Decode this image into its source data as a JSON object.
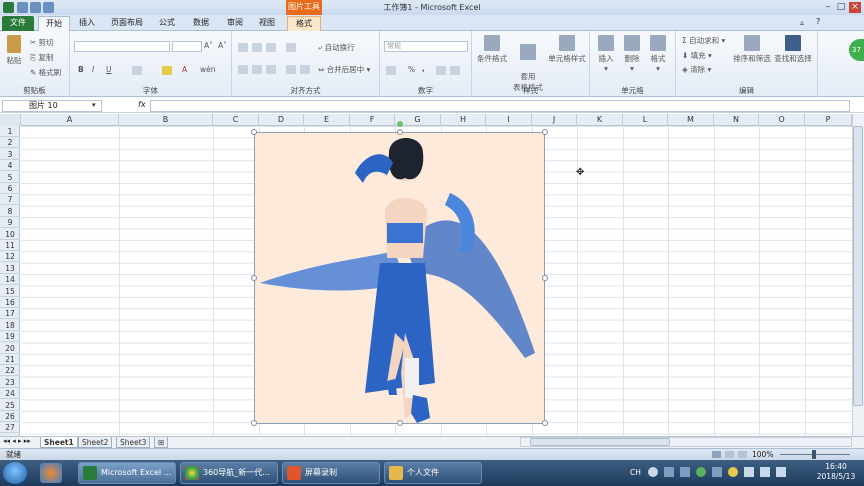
{
  "window": {
    "title": "工作簿1 - Microsoft Excel",
    "context_tab": "图片工具"
  },
  "tabs": [
    "文件",
    "开始",
    "插入",
    "页面布局",
    "公式",
    "数据",
    "审阅",
    "视图",
    "格式"
  ],
  "ribbon": {
    "clipboard": {
      "paste": "粘贴",
      "cut": "剪切",
      "copy": "复制",
      "format_painter": "格式刷",
      "label": "剪贴板"
    },
    "font": {
      "bold": "B",
      "italic": "I",
      "underline": "U",
      "label": "字体"
    },
    "alignment": {
      "wrap": "自动换行",
      "merge": "合并后居中",
      "label": "对齐方式"
    },
    "number": {
      "format": "常规",
      "percent": "%",
      "comma": ",",
      "label": "数字"
    },
    "styles": {
      "conditional": "条件格式",
      "table": "套用\n表格格式",
      "cell": "单元格样式",
      "label": "样式"
    },
    "cells": {
      "insert": "插入",
      "delete": "删除",
      "format": "格式",
      "label": "单元格"
    },
    "editing": {
      "autosum": "Σ 自动求和",
      "fill": "填充",
      "clear": "清除",
      "sort": "排序和筛选",
      "find": "查找和选择",
      "label": "编辑"
    }
  },
  "formula_bar": {
    "name_box": "图片 10",
    "fx": "fx",
    "value": ""
  },
  "columns": [
    "A",
    "B",
    "C",
    "D",
    "E",
    "F",
    "G",
    "H",
    "I",
    "J",
    "K",
    "L",
    "M",
    "N",
    "O",
    "P"
  ],
  "rows": [
    "1",
    "2",
    "3",
    "4",
    "5",
    "6",
    "7",
    "8",
    "9",
    "10",
    "11",
    "12",
    "13",
    "14",
    "15",
    "16",
    "17",
    "18",
    "19",
    "20",
    "21",
    "22",
    "23",
    "24",
    "25",
    "26",
    "27"
  ],
  "sheets": [
    "Sheet1",
    "Sheet2",
    "Sheet3"
  ],
  "status": {
    "ready": "就绪",
    "zoom": "100%"
  },
  "taskbar": {
    "items": [
      "Microsoft Excel ...",
      "360导航_新一代...",
      "屏幕录制",
      "个人文件"
    ],
    "ime": "CH",
    "time": "16:40",
    "date": "2018/5/13"
  },
  "badge": "37",
  "colors": {
    "file_tab": "#2a7a3a",
    "context_tab": "#e86b1b",
    "picture_bg": "#fdeadb",
    "dress": "#2c64c4"
  }
}
